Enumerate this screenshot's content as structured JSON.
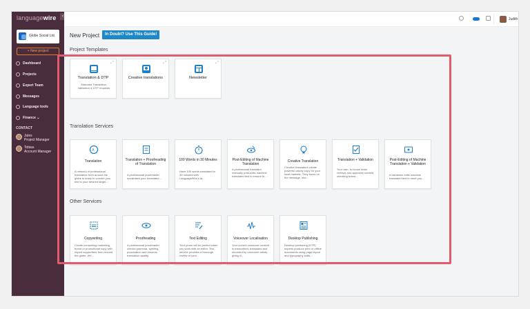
{
  "colors": {
    "sidebar": "#4a2d3d",
    "accent_orange": "#e07b2a",
    "brand_blue": "#1d87c8",
    "highlight": "#e35a6b"
  },
  "sidebar": {
    "logo_part1": "language",
    "logo_part2": "wire",
    "org_name": "Globe Social Ltd.",
    "new_project": "+ New project",
    "items": [
      {
        "label": "Dashboard",
        "icon": "dashboard-icon"
      },
      {
        "label": "Projects",
        "icon": "folder-icon"
      },
      {
        "label": "Expert Team",
        "icon": "team-icon"
      },
      {
        "label": "Messages",
        "icon": "messages-icon"
      },
      {
        "label": "Language tools",
        "icon": "tools-icon"
      },
      {
        "label": "Finance ⌄",
        "icon": "finance-icon"
      }
    ],
    "contact_heading": "CONTACT",
    "contacts": [
      {
        "name": "Jules",
        "role": "Project Manager"
      },
      {
        "name": "Tobias",
        "role": "Account Manager"
      }
    ]
  },
  "topbar": {
    "user_name": "Judith",
    "caret": "▾"
  },
  "main": {
    "title": "New Project",
    "guide_button": "In Doubt? Use This Guide!",
    "sections": {
      "templates": "Project Templates",
      "translation": "Translation Services",
      "other": "Other Services"
    },
    "templates": [
      {
        "title": "Translation & DTP",
        "desc": "Standard Translation, Validation & DTP requests"
      },
      {
        "title": "Creative translations",
        "desc": ""
      },
      {
        "title": "Newsletter",
        "desc": ""
      }
    ],
    "translation_services": [
      {
        "title": "Translation",
        "desc": "A network of professional translators from around the globe is ready to convert your text to your desired target..."
      },
      {
        "title": "Translation + Proofreading of Translation",
        "desc": "A professional proofreader scrutinises your translated..."
      },
      {
        "title": "100 Words in 30 Minutes",
        "desc": "Have 100 words translated in 30 minutes with LanguageWire's ta..."
      },
      {
        "title": "Post-Editing of Machine Translation",
        "desc": "A professional translator manually post-edits machine translated text to ensure th..."
      },
      {
        "title": "Creative Translation",
        "desc": "Creative translators create powerful catchy copy for your local markets. They focus on the message, stor..."
      },
      {
        "title": "Translation + Validation",
        "desc": "Your own, in-house team reviews and approves content, checking brand..."
      },
      {
        "title": "Post-Editing of Machine Translation + Validation",
        "desc": "A translator edits machine translated text to meet you..."
      }
    ],
    "other_services": [
      {
        "title": "Copywriting",
        "desc": "Create compelling marketing, brand or promotional copy with expert copywriters from around the globe. We..."
      },
      {
        "title": "Proofreading",
        "desc": "A professional proofreader checks grammar, spelling, punctuation and ensures translation quality."
      },
      {
        "title": "Text Editing",
        "desc": "Your prose will be perfect when you work with an editor. This service provides a thorough review of your..."
      },
      {
        "title": "Voiceover Localisation",
        "desc": "Your current voiceover content is transcribed, translated and recorded by voiceover artists, giving it..."
      },
      {
        "title": "Desktop Publishing",
        "desc": "Desktop publishing (DTP) experts produce print or offline documents using page layout and typography skills..."
      }
    ]
  }
}
